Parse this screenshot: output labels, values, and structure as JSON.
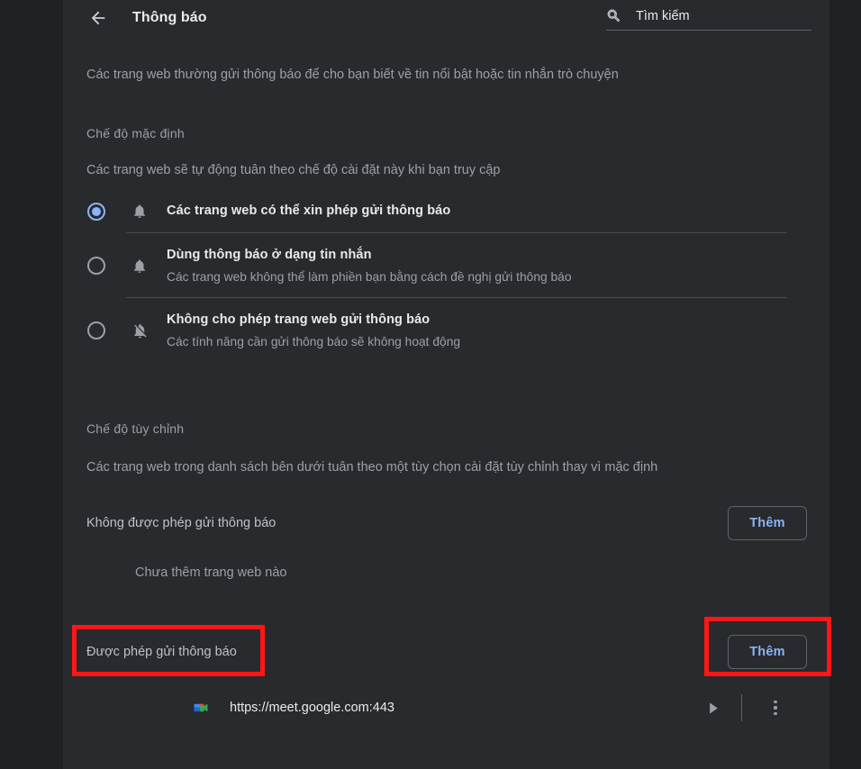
{
  "window": {
    "background_color": "#202124",
    "card_color": "#292a2d",
    "accent_color": "#8ab4f8",
    "annotation_color": "#ff1616"
  },
  "header": {
    "back_label": "Quay lại",
    "title": "Thông báo",
    "search": {
      "placeholder": "Tìm kiếm",
      "value": ""
    }
  },
  "intro": "Các trang web thường gửi thông báo để cho bạn biết về tin nổi bật hoặc tin nhắn trò chuyện",
  "default_mode": {
    "title": "Chế độ mặc định",
    "description": "Các trang web sẽ tự động tuân theo chế độ cài đặt này khi bạn truy cập",
    "options": [
      {
        "icon": "bell-icon",
        "primary": "Các trang web có thể xin phép gửi thông báo",
        "secondary": "",
        "selected": true
      },
      {
        "icon": "bell-icon",
        "primary": "Dùng thông báo ở dạng tin nhắn",
        "secondary": "Các trang web không thể làm phiền bạn bằng cách đề nghị gửi thông báo",
        "selected": false
      },
      {
        "icon": "bell-off-icon",
        "primary": "Không cho phép trang web gửi thông báo",
        "secondary": "Các tính năng cần gửi thông báo sẽ không hoạt động",
        "selected": false
      }
    ]
  },
  "custom_mode": {
    "title": "Chế độ tùy chỉnh",
    "description": "Các trang web trong danh sách bên dưới tuân theo một tùy chọn cài đặt tùy chỉnh thay vì mặc định",
    "blocked": {
      "label": "Không được phép gửi thông báo",
      "add_label": "Thêm",
      "empty_text": "Chưa thêm trang web nào",
      "sites": []
    },
    "allowed": {
      "label": "Được phép gửi thông báo",
      "add_label": "Thêm",
      "sites": [
        {
          "favicon": "google-meet-icon",
          "url": "https://meet.google.com:443",
          "expand_icon": "triangle-right-icon",
          "menu_icon": "kebab-menu-icon"
        }
      ]
    }
  },
  "annotations": [
    {
      "name": "allowed-label-highlight",
      "target": "Được phép gửi thông báo"
    },
    {
      "name": "allowed-add-button-highlight",
      "target": "Thêm"
    }
  ]
}
